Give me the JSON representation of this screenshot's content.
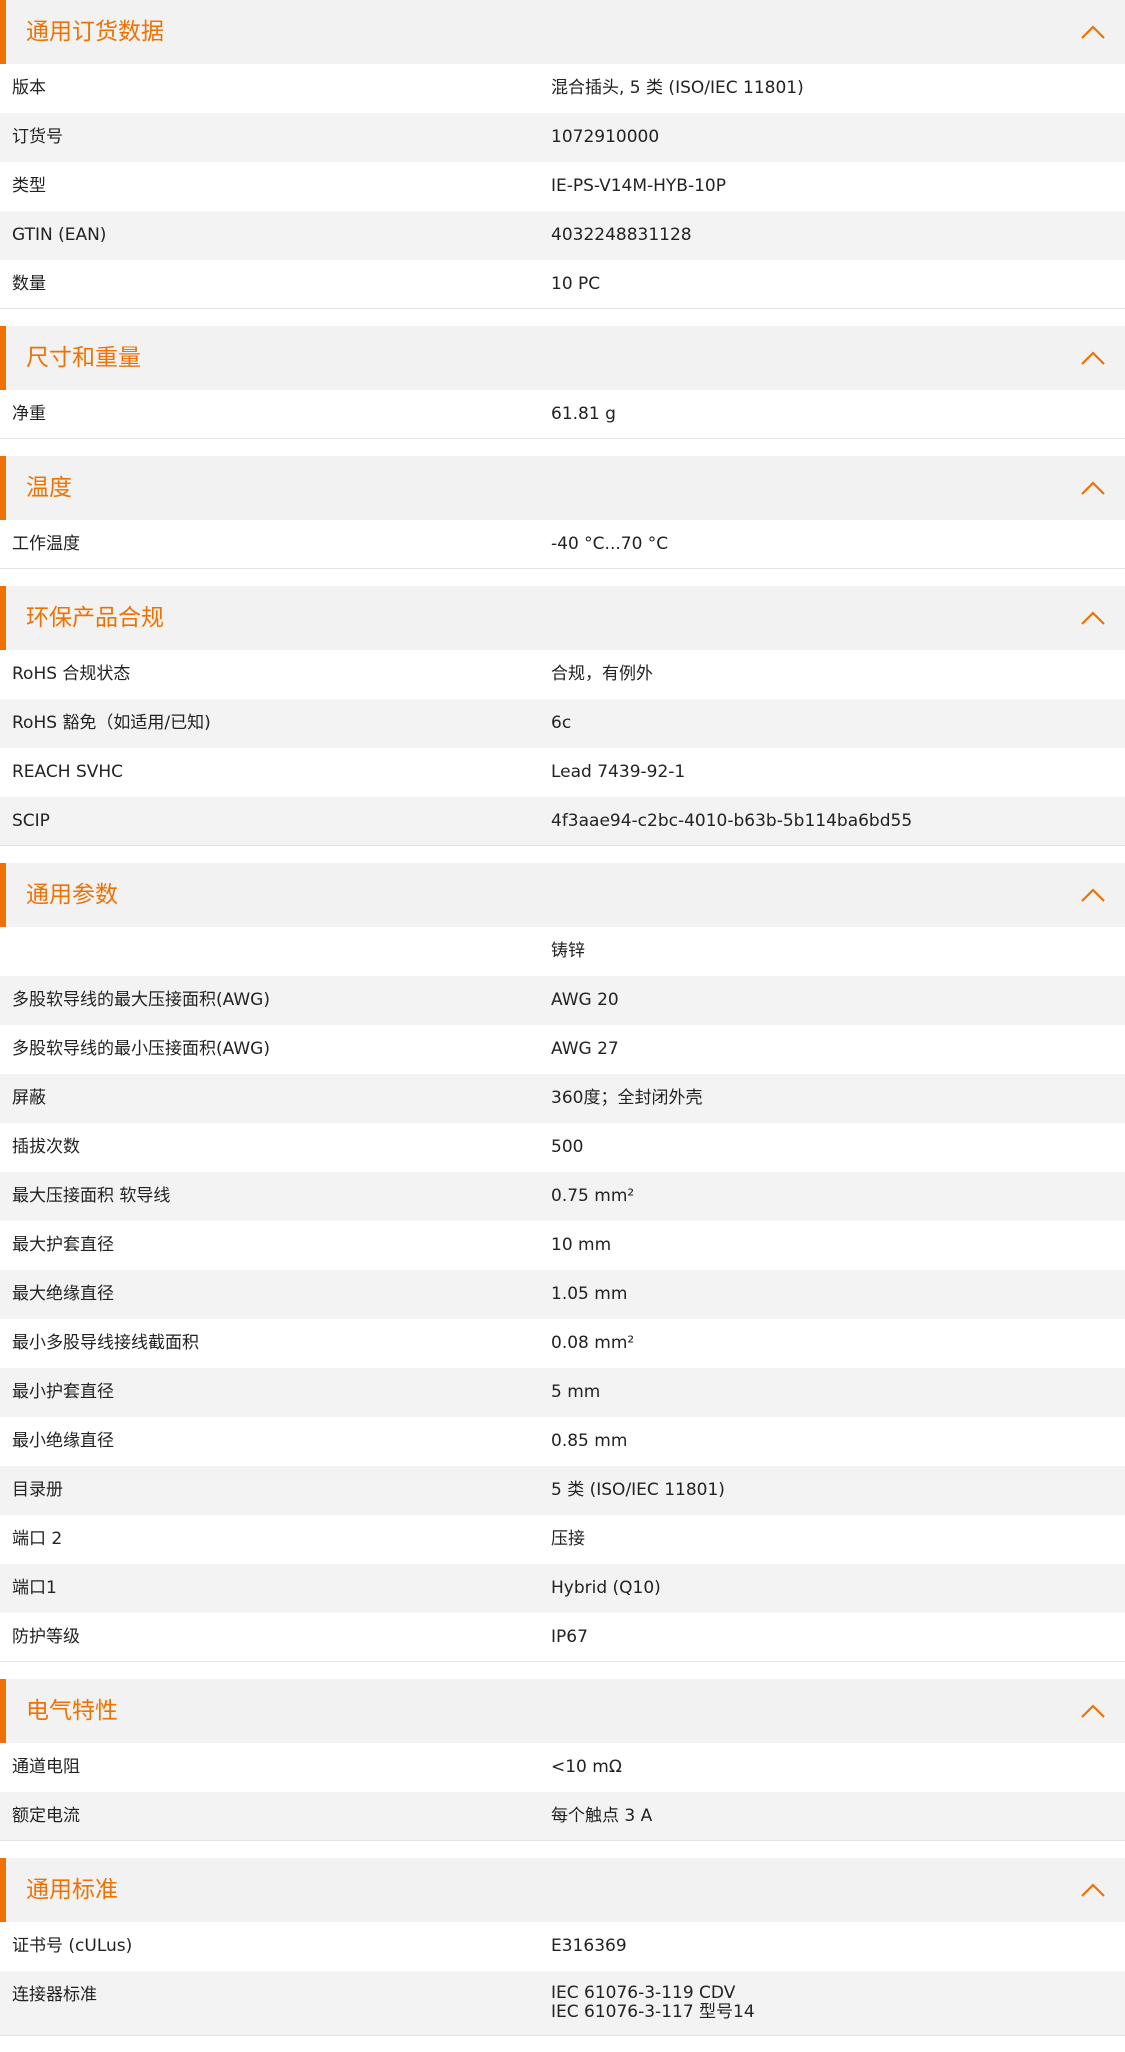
{
  "colors": {
    "accent": "#ee7203",
    "header_bg": "#f2f2f2",
    "row_alt_bg": "#f3f3f3"
  },
  "icons": {
    "section_toggle": "chevron-up-icon"
  },
  "sections": [
    {
      "title": "通用订货数据",
      "rows": [
        {
          "label": "版本",
          "value": "混合插头, 5 类 (ISO/IEC 11801)"
        },
        {
          "label": "订货号",
          "value": "1072910000"
        },
        {
          "label": "类型",
          "value": "IE-PS-V14M-HYB-10P"
        },
        {
          "label": "GTIN (EAN)",
          "value": "4032248831128"
        },
        {
          "label": "数量",
          "value": "10  PC"
        }
      ]
    },
    {
      "title": "尺寸和重量",
      "rows": [
        {
          "label": "净重",
          "value": "61.81  g"
        }
      ]
    },
    {
      "title": "温度",
      "rows": [
        {
          "label": "工作温度",
          "value": "-40 °C...70 °C"
        }
      ]
    },
    {
      "title": "环保产品合规",
      "rows": [
        {
          "label": "RoHS 合规状态",
          "value": "合规，有例外"
        },
        {
          "label": "RoHS 豁免（如适用/已知)",
          "value": "6c"
        },
        {
          "label": "REACH SVHC",
          "value": "Lead 7439-92-1"
        },
        {
          "label": "SCIP",
          "value": "4f3aae94-c2bc-4010-b63b-5b114ba6bd55"
        }
      ]
    },
    {
      "title": "通用参数",
      "rows": [
        {
          "label": "",
          "value": "铸锌"
        },
        {
          "label": "多股软导线的最大压接面积(AWG)",
          "value": "AWG 20"
        },
        {
          "label": "多股软导线的最小压接面积(AWG)",
          "value": "AWG 27"
        },
        {
          "label": "屏蔽",
          "value": "360度；全封闭外壳"
        },
        {
          "label": "插拔次数",
          "value": "500"
        },
        {
          "label": "最大压接面积 软导线",
          "value": "0.75  mm²"
        },
        {
          "label": "最大护套直径",
          "value": "10  mm"
        },
        {
          "label": "最大绝缘直径",
          "value": "1.05  mm"
        },
        {
          "label": "最小多股导线接线截面积",
          "value": "0.08  mm²"
        },
        {
          "label": "最小护套直径",
          "value": "5  mm"
        },
        {
          "label": "最小绝缘直径",
          "value": "0.85  mm"
        },
        {
          "label": "目录册",
          "value": "5 类 (ISO/IEC 11801)"
        },
        {
          "label": "端口 2",
          "value": "压接"
        },
        {
          "label": "端口1",
          "value": "Hybrid (Q10)"
        },
        {
          "label": "防护等级",
          "value": "IP67"
        }
      ]
    },
    {
      "title": "电气特性",
      "rows": [
        {
          "label": "通道电阻",
          "value": "<10 mΩ"
        },
        {
          "label": "额定电流",
          "value": "每个触点 3 A"
        }
      ]
    },
    {
      "title": "通用标准",
      "rows": [
        {
          "label": "证书号 (cULus)",
          "value": "E316369"
        },
        {
          "label": "连接器标准",
          "values": [
            "IEC 61076-3-119 CDV",
            "IEC 61076-3-117 型号14"
          ]
        }
      ]
    }
  ]
}
